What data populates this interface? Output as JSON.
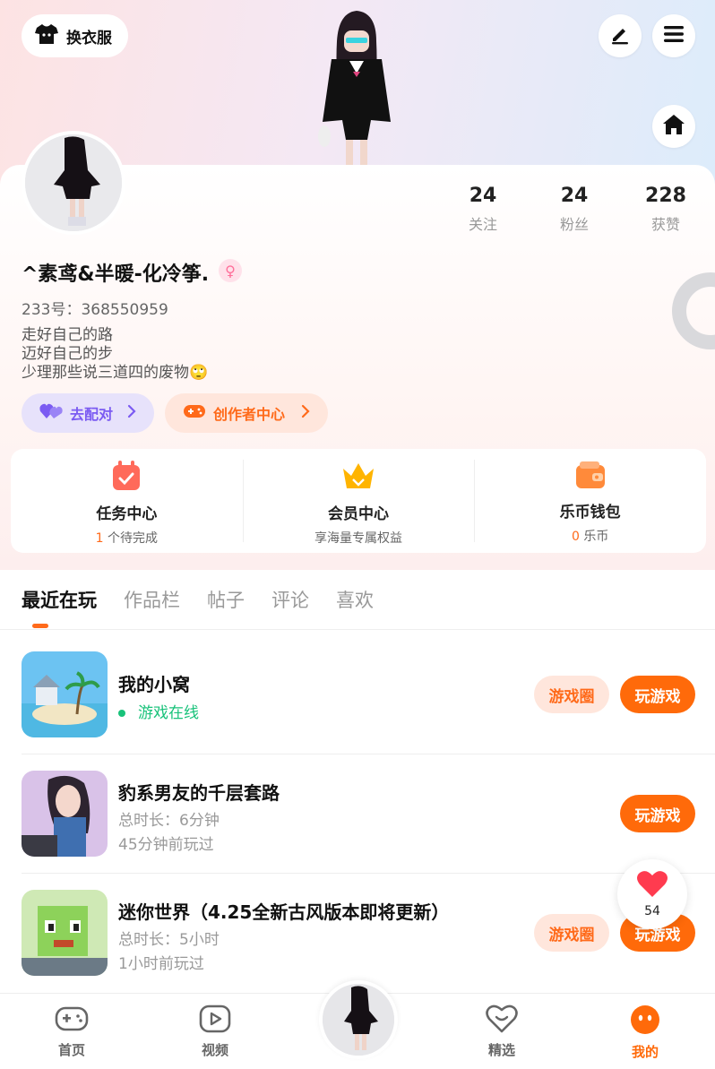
{
  "header": {
    "outfit_label": "换衣服",
    "edit_icon": "pencil-icon",
    "menu_icon": "hamburger-menu-icon",
    "home_icon": "home-icon"
  },
  "profile": {
    "username": "^素鸢&半暖-化冷筝.",
    "gender_symbol": "♀",
    "uid": "233号：368550959",
    "bio": [
      "走好自己的路",
      "迈好自己的步",
      "少理那些说三道四的废物🙄"
    ],
    "stats": [
      {
        "num": "24",
        "label": "关注"
      },
      {
        "num": "24",
        "label": "粉丝"
      },
      {
        "num": "228",
        "label": "获赞"
      }
    ],
    "match_label": "去配对",
    "creator_label": "创作者中心"
  },
  "quick_links": [
    {
      "title": "任务中心",
      "highlight": "1",
      "sub": " 个待完成"
    },
    {
      "title": "会员中心",
      "highlight": "",
      "sub": "享海量专属权益"
    },
    {
      "title": "乐币钱包",
      "highlight": "0",
      "sub": " 乐币"
    }
  ],
  "tabs": [
    "最近在玩",
    "作品栏",
    "帖子",
    "评论",
    "喜欢"
  ],
  "games": [
    {
      "title": "我的小窝",
      "line1": "游戏在线",
      "line2": "",
      "circle_label": "游戏圈",
      "play_label": "玩游戏"
    },
    {
      "title": "豹系男友的千层套路",
      "line1": "总时长：6分钟",
      "line2": "45分钟前玩过",
      "circle_label": "",
      "play_label": "玩游戏"
    },
    {
      "title": "迷你世界（4.25全新古风版本即将更新）",
      "line1": "总时长：5小时",
      "line2": "1小时前玩过",
      "circle_label": "游戏圈",
      "play_label": "玩游戏"
    }
  ],
  "like_float": {
    "count": "54"
  },
  "bottom_nav": [
    {
      "label": "首页"
    },
    {
      "label": "视频"
    },
    {
      "label": "精选"
    },
    {
      "label": "我的"
    }
  ],
  "colors": {
    "accent": "#ff6a0a",
    "purple": "#7b5bf2",
    "online": "#18c27a"
  }
}
